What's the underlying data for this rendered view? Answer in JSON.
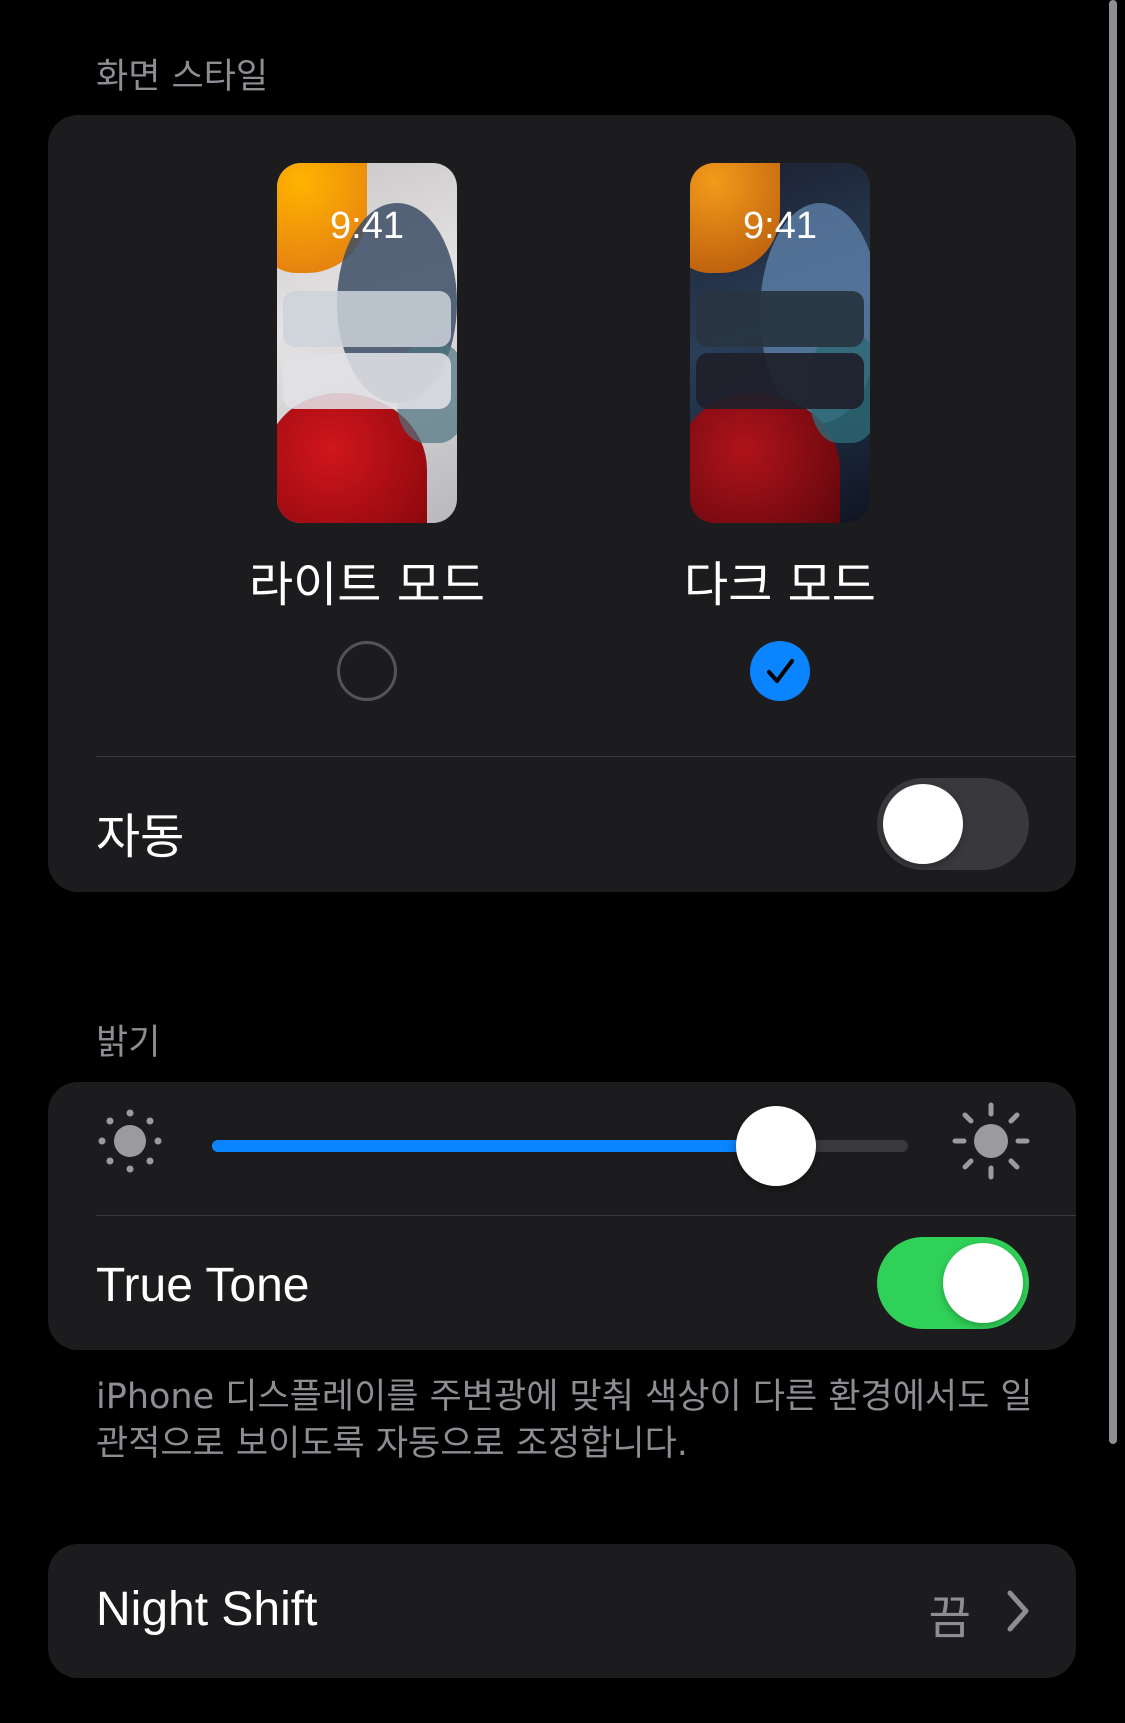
{
  "appearance": {
    "header": "화면 스타일",
    "light_mode": {
      "label": "라이트 모드",
      "preview_time": "9:41",
      "selected": false
    },
    "dark_mode": {
      "label": "다크 모드",
      "preview_time": "9:41",
      "selected": true
    },
    "automatic": {
      "label": "자동",
      "on": false
    }
  },
  "brightness": {
    "header": "밝기",
    "slider_value": 0.81,
    "true_tone": {
      "label": "True Tone",
      "on": true
    },
    "footnote": "iPhone 디스플레이를 주변광에 맞춰 색상이 다른 환경에서도 일관적으로 보이도록 자동으로 조정합니다."
  },
  "night_shift": {
    "label": "Night Shift",
    "value": "끔"
  },
  "icons": {
    "brightness_low": "sun-small-icon",
    "brightness_high": "sun-large-icon",
    "checkmark": "checkmark-icon",
    "chevron": "chevron-right-icon"
  },
  "colors": {
    "accent_blue": "#0a84ff",
    "toggle_on_green": "#30d158",
    "toggle_off_track": "#39393d",
    "card_background": "#1c1c1e"
  }
}
